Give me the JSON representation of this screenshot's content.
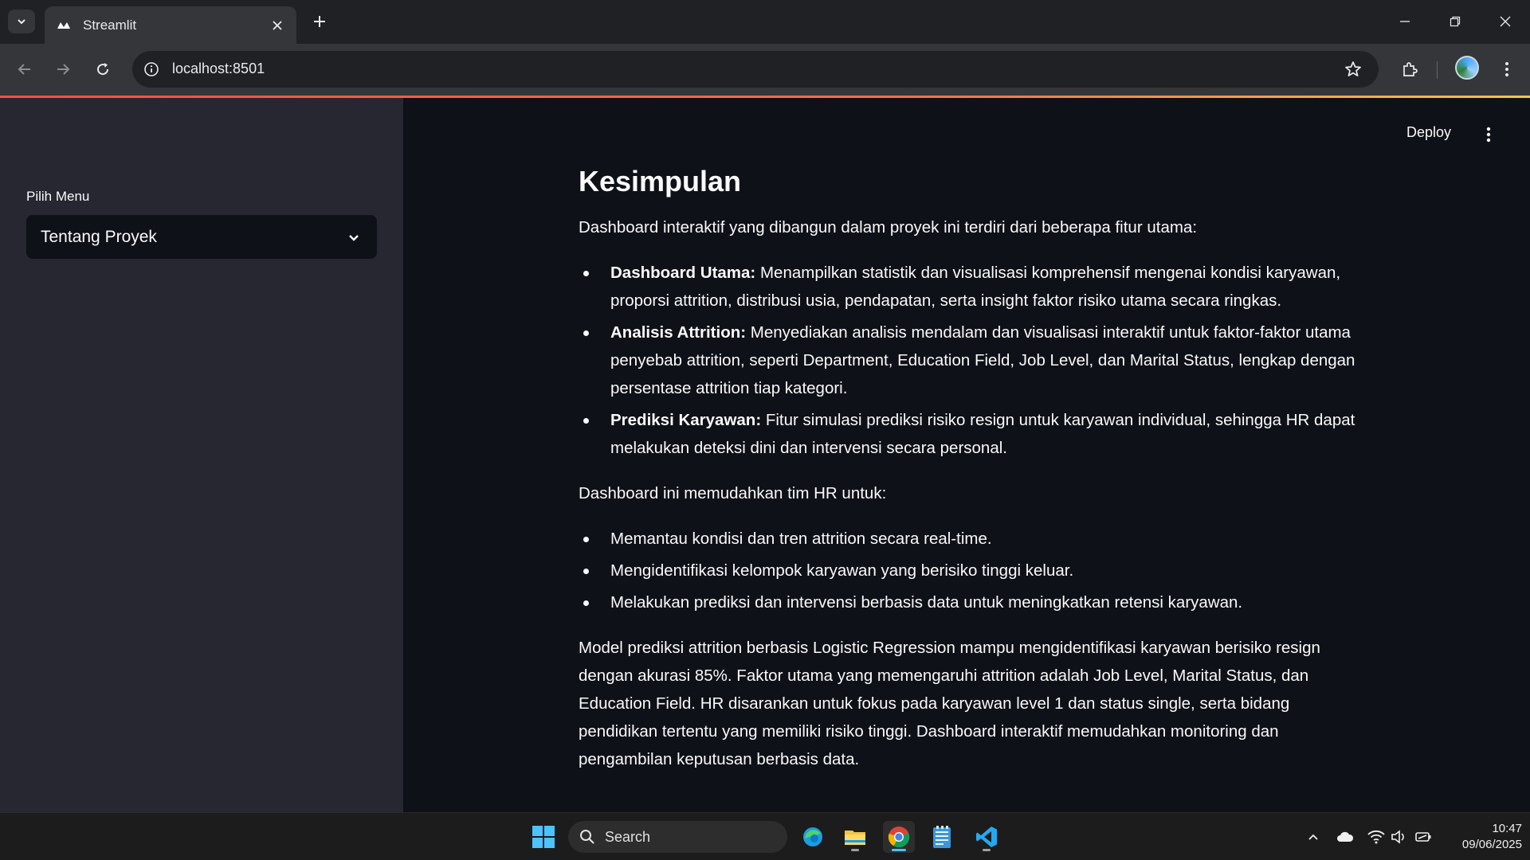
{
  "browser": {
    "tab_title": "Streamlit",
    "url": "localhost:8501"
  },
  "sidebar": {
    "menu_label": "Pilih Menu",
    "menu_selected": "Tentang Proyek"
  },
  "header": {
    "deploy_label": "Deploy"
  },
  "content": {
    "title": "Kesimpulan",
    "intro": "Dashboard interaktif yang dibangun dalam proyek ini terdiri dari beberapa fitur utama:",
    "features": [
      {
        "name": "Dashboard Utama:",
        "text": " Menampilkan statistik dan visualisasi komprehensif mengenai kondisi karyawan, proporsi attrition, distribusi usia, pendapatan, serta insight faktor risiko utama secara ringkas."
      },
      {
        "name": "Analisis Attrition:",
        "text": " Menyediakan analisis mendalam dan visualisasi interaktif untuk faktor-faktor utama penyebab attrition, seperti Department, Education Field, Job Level, dan Marital Status, lengkap dengan persentase attrition tiap kategori."
      },
      {
        "name": "Prediksi Karyawan:",
        "text": " Fitur simulasi prediksi risiko resign untuk karyawan individual, sehingga HR dapat melakukan deteksi dini dan intervensi secara personal."
      }
    ],
    "benefits_intro": "Dashboard ini memudahkan tim HR untuk:",
    "benefits": [
      "Memantau kondisi dan tren attrition secara real-time.",
      "Mengidentifikasi kelompok karyawan yang berisiko tinggi keluar.",
      "Melakukan prediksi dan intervensi berbasis data untuk meningkatkan retensi karyawan."
    ],
    "conclusion": "Model prediksi attrition berbasis Logistic Regression mampu mengidentifikasi karyawan berisiko resign dengan akurasi 85%. Faktor utama yang memengaruhi attrition adalah Job Level, Marital Status, dan Education Field. HR disarankan untuk fokus pada karyawan level 1 dan status single, serta bidang pendidikan tertentu yang memiliki risiko tinggi. Dashboard interaktif memudahkan monitoring dan pengambilan keputusan berbasis data."
  },
  "taskbar": {
    "search_label": "Search",
    "time": "10:47",
    "date": "09/06/2025"
  },
  "colors": {
    "streamlit_accent": "#ff4b4b",
    "sidebar_bg": "#262730",
    "main_bg": "#0e1117"
  }
}
